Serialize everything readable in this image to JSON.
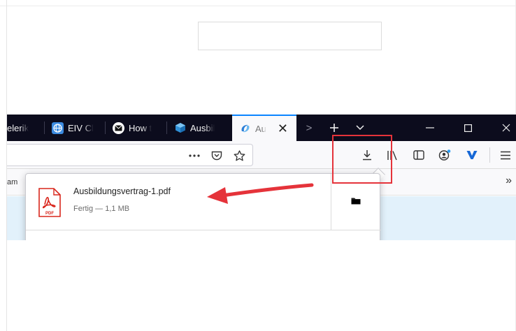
{
  "tabs": [
    {
      "label": "elerik",
      "favicon": "telerik-icon"
    },
    {
      "label": "EIV Cl",
      "favicon": "eiv-globe-icon",
      "color": "#3c8be0"
    },
    {
      "label": "How t",
      "favicon": "mail-circle-icon",
      "color": "#ffffff"
    },
    {
      "label": "Ausbil",
      "favicon": "cube-icon",
      "color": "#2f8fd6"
    },
    {
      "label": "Au",
      "favicon": "swirl-icon",
      "color": "#2a7fd8",
      "active": true
    }
  ],
  "window_controls": {
    "minimize": "minimize-icon",
    "maximize": "maximize-icon",
    "close": "close-icon"
  },
  "bookmarks": {
    "left_fragment": "am",
    "overflow": "»"
  },
  "downloads": {
    "items": [
      {
        "filename": "Ausbildungsvertrag-1.pdf",
        "status": "Fertig — 1,1 MB",
        "icon": "pdf-file-icon",
        "icon_badge": "PDF"
      }
    ]
  },
  "colors": {
    "tabstrip": "#0c0c1d",
    "toolbar": "#f9f9fb",
    "accent": "#0a84ff",
    "annotation_red": "#e5333a",
    "pdf_red": "#d9261c",
    "content_blue": "#e2f1fb"
  }
}
